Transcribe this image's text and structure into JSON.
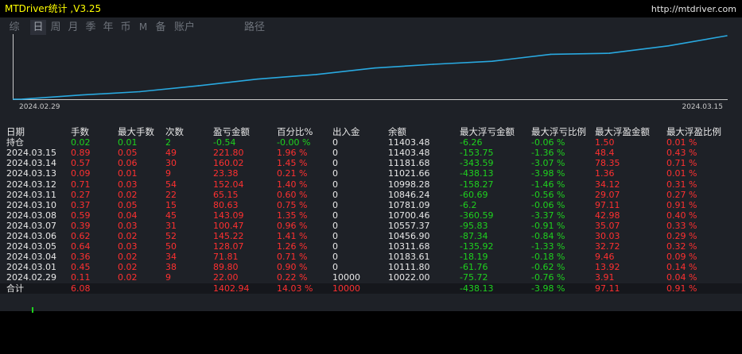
{
  "app": {
    "title": "MTDriver统计 ,V3.25",
    "url": "http://mtdriver.com"
  },
  "tabs": [
    {
      "label": "综",
      "active": false
    },
    {
      "label": "日",
      "active": true
    },
    {
      "label": "周",
      "active": false
    },
    {
      "label": "月",
      "active": false
    },
    {
      "label": "季",
      "active": false
    },
    {
      "label": "年",
      "active": false
    },
    {
      "label": "币",
      "active": false
    },
    {
      "label": "M",
      "active": false
    },
    {
      "label": "备",
      "active": false
    },
    {
      "label": "账户",
      "active": false
    },
    {
      "label": "路径",
      "active": false
    }
  ],
  "chart_data": {
    "type": "line",
    "x_start_label": "2024.02.29",
    "x_end_label": "2024.03.15",
    "line_color": "#29a9e0",
    "x": [
      "2024.02.29",
      "2024.03.01",
      "2024.03.04",
      "2024.03.05",
      "2024.03.06",
      "2024.03.07",
      "2024.03.08",
      "2024.03.10",
      "2024.03.11",
      "2024.03.12",
      "2024.03.13",
      "2024.03.14",
      "2024.03.15"
    ],
    "values": [
      10022.0,
      10111.8,
      10183.61,
      10311.68,
      10456.9,
      10557.37,
      10700.46,
      10781.09,
      10846.24,
      10998.28,
      11021.66,
      11181.68,
      11403.48
    ]
  },
  "table": {
    "headers": [
      "日期",
      "手数",
      "最大手数",
      "次数",
      "盈亏金额",
      "百分比%",
      "出入金",
      "余额",
      "最大浮亏金额",
      "最大浮亏比例",
      "最大浮盈金额",
      "最大浮盈比例"
    ],
    "position_row": {
      "label": "持仓",
      "cells": [
        "0.02",
        "0.01",
        "2",
        "-0.54",
        "-0.00 %",
        "0",
        "11403.48",
        "-6.26",
        "-0.06 %",
        "1.50",
        "0.01 %"
      ]
    },
    "rows": [
      [
        "2024.03.15",
        "0.89",
        "0.05",
        "49",
        "221.80",
        "1.96 %",
        "0",
        "11403.48",
        "-153.75",
        "-1.36 %",
        "48.4",
        "0.43 %"
      ],
      [
        "2024.03.14",
        "0.57",
        "0.06",
        "30",
        "160.02",
        "1.45 %",
        "0",
        "11181.68",
        "-343.59",
        "-3.07 %",
        "78.35",
        "0.71 %"
      ],
      [
        "2024.03.13",
        "0.09",
        "0.01",
        "9",
        "23.38",
        "0.21 %",
        "0",
        "11021.66",
        "-438.13",
        "-3.98 %",
        "1.36",
        "0.01 %"
      ],
      [
        "2024.03.12",
        "0.71",
        "0.03",
        "54",
        "152.04",
        "1.40 %",
        "0",
        "10998.28",
        "-158.27",
        "-1.46 %",
        "34.12",
        "0.31 %"
      ],
      [
        "2024.03.11",
        "0.27",
        "0.02",
        "22",
        "65.15",
        "0.60 %",
        "0",
        "10846.24",
        "-60.69",
        "-0.56 %",
        "29.07",
        "0.27 %"
      ],
      [
        "2024.03.10",
        "0.37",
        "0.05",
        "15",
        "80.63",
        "0.75 %",
        "0",
        "10781.09",
        "-6.2",
        "-0.06 %",
        "97.11",
        "0.91 %"
      ],
      [
        "2024.03.08",
        "0.59",
        "0.04",
        "45",
        "143.09",
        "1.35 %",
        "0",
        "10700.46",
        "-360.59",
        "-3.37 %",
        "42.98",
        "0.40 %"
      ],
      [
        "2024.03.07",
        "0.39",
        "0.03",
        "31",
        "100.47",
        "0.96 %",
        "0",
        "10557.37",
        "-95.83",
        "-0.91 %",
        "35.07",
        "0.33 %"
      ],
      [
        "2024.03.06",
        "0.62",
        "0.02",
        "52",
        "145.22",
        "1.41 %",
        "0",
        "10456.90",
        "-87.34",
        "-0.84 %",
        "30.03",
        "0.29 %"
      ],
      [
        "2024.03.05",
        "0.64",
        "0.03",
        "50",
        "128.07",
        "1.26 %",
        "0",
        "10311.68",
        "-135.92",
        "-1.33 %",
        "32.72",
        "0.32 %"
      ],
      [
        "2024.03.04",
        "0.36",
        "0.02",
        "34",
        "71.81",
        "0.71 %",
        "0",
        "10183.61",
        "-18.19",
        "-0.18 %",
        "9.46",
        "0.09 %"
      ],
      [
        "2024.03.01",
        "0.45",
        "0.02",
        "38",
        "89.80",
        "0.90 %",
        "0",
        "10111.80",
        "-61.76",
        "-0.62 %",
        "13.92",
        "0.14 %"
      ],
      [
        "2024.02.29",
        "0.11",
        "0.02",
        "9",
        "22.00",
        "0.22 %",
        "10000",
        "10022.00",
        "-75.72",
        "-0.76 %",
        "3.91",
        "0.04 %"
      ]
    ],
    "total_row": {
      "label": "合计",
      "cells": [
        "6.08",
        "",
        "",
        "1402.94",
        "14.03 %",
        "10000",
        "",
        "-438.13",
        "-3.98 %",
        "97.11",
        "0.91 %"
      ]
    }
  },
  "colors": {
    "panel_bg": "#1e2127",
    "title_yellow": "#ffff00",
    "positive_red": "#ff3030",
    "negative_green": "#1ed21e",
    "chart_line": "#29a9e0"
  }
}
